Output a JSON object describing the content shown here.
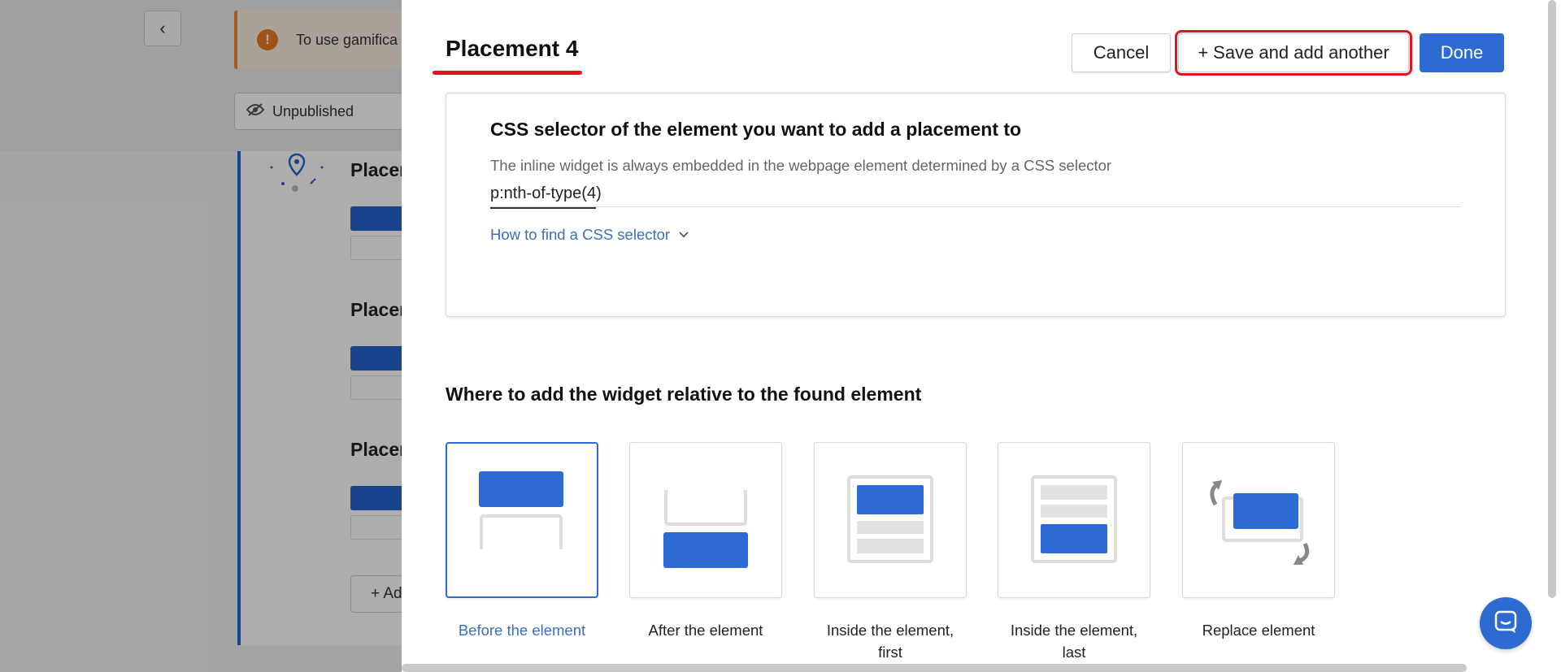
{
  "background": {
    "warning_text": "To use gamifica",
    "status_label": "Unpublished",
    "placement_labels": [
      "Placen",
      "Placen",
      "Placen"
    ],
    "add_label": "+ Ad"
  },
  "drawer": {
    "title": "Placement 4",
    "buttons": {
      "cancel": "Cancel",
      "save_plus": "+",
      "save_and_add": "Save and add another",
      "done": "Done"
    },
    "css_section": {
      "heading": "CSS selector of the element you want to add a placement to",
      "description": "The inline widget is always embedded in the webpage element determined by a CSS selector",
      "selector_value": "p:nth-of-type(4)",
      "help_link": "How to find a CSS selector"
    },
    "position_section": {
      "heading": "Where to add the widget relative to the found element",
      "options": [
        {
          "label": "Before the element",
          "selected": true
        },
        {
          "label": "After the element",
          "selected": false
        },
        {
          "label": "Inside the element, first",
          "selected": false
        },
        {
          "label": "Inside the element, last",
          "selected": false
        },
        {
          "label": "Replace element",
          "selected": false
        }
      ]
    }
  },
  "colors": {
    "accent": "#2d6bd3",
    "highlight": "#e0141e",
    "link": "#3d6fb3"
  }
}
